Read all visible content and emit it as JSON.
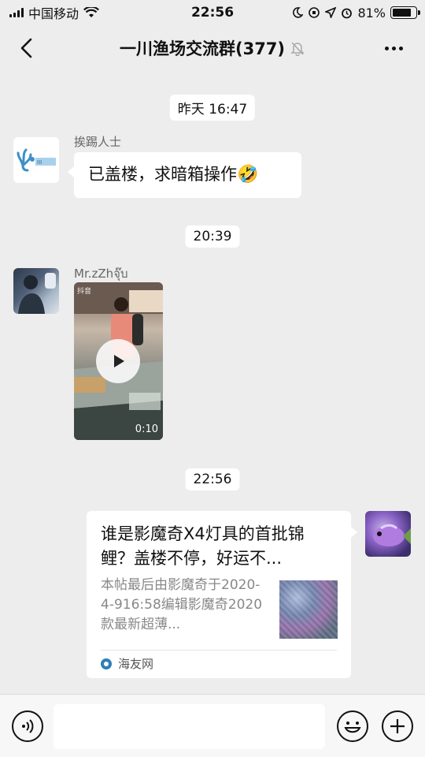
{
  "status_bar": {
    "carrier": "中国移动",
    "time": "22:56",
    "battery_percent": "81%",
    "battery_level": 0.81
  },
  "nav": {
    "title": "一川渔场交流群(377)",
    "icons": [
      "back-chevron-icon",
      "mute-bell-icon",
      "more-dots-icon"
    ]
  },
  "messages": [
    {
      "type": "time",
      "text": "昨天 16:47"
    },
    {
      "type": "text",
      "sender": "挨踢人士",
      "text": "已盖楼，求暗箱操作",
      "emoji": "🤣"
    },
    {
      "type": "time",
      "text": "20:39"
    },
    {
      "type": "video",
      "sender": "Mr.zZhจุ๊บ",
      "duration": "0:10",
      "watermark_label": "抖音"
    },
    {
      "type": "time",
      "text": "22:56"
    },
    {
      "type": "link_card",
      "title": "谁是影魔奇X4灯具的首批锦鲤？盖楼不停，好运不...",
      "description": "本帖最后由影魔奇于2020-4-916:58编辑影魔奇2020款最新超薄...",
      "source": "海友网"
    }
  ],
  "input_bar": {
    "placeholder": "",
    "icons": [
      "voice-icon",
      "emoji-icon",
      "plus-icon"
    ]
  },
  "colors": {
    "background": "#ededed",
    "bubble": "#ffffff",
    "source_dot": "#2f7fb6"
  }
}
